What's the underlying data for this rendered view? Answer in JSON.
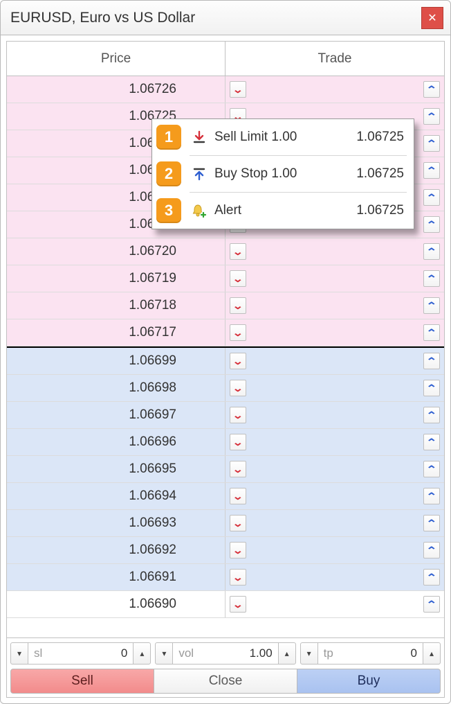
{
  "window": {
    "title": "EURUSD, Euro vs US Dollar"
  },
  "headers": {
    "price": "Price",
    "trade": "Trade"
  },
  "ask_rows": [
    {
      "price": "1.06726"
    },
    {
      "price": "1.06725"
    },
    {
      "price": "1.06724"
    },
    {
      "price": "1.06723"
    },
    {
      "price": "1.06722"
    },
    {
      "price": "1.06721"
    },
    {
      "price": "1.06720"
    },
    {
      "price": "1.06719"
    },
    {
      "price": "1.06718"
    },
    {
      "price": "1.06717"
    }
  ],
  "bid_rows": [
    {
      "price": "1.06699"
    },
    {
      "price": "1.06698"
    },
    {
      "price": "1.06697"
    },
    {
      "price": "1.06696"
    },
    {
      "price": "1.06695"
    },
    {
      "price": "1.06694"
    },
    {
      "price": "1.06693"
    },
    {
      "price": "1.06692"
    },
    {
      "price": "1.06691"
    },
    {
      "price": "1.06690"
    }
  ],
  "popup": {
    "items": [
      {
        "marker": "1",
        "icon": "arrow-to-line-down-red",
        "label": "Sell Limit 1.00",
        "price": "1.06725"
      },
      {
        "marker": "2",
        "icon": "arrow-to-line-up-blue",
        "label": "Buy Stop 1.00",
        "price": "1.06725"
      },
      {
        "marker": "3",
        "icon": "bell-add",
        "label": "Alert",
        "price": "1.06725"
      }
    ]
  },
  "footer": {
    "sl": {
      "placeholder": "sl",
      "value": "0"
    },
    "vol": {
      "placeholder": "vol",
      "value": "1.00"
    },
    "tp": {
      "placeholder": "tp",
      "value": "0"
    },
    "sell": "Sell",
    "close": "Close",
    "buy": "Buy"
  }
}
